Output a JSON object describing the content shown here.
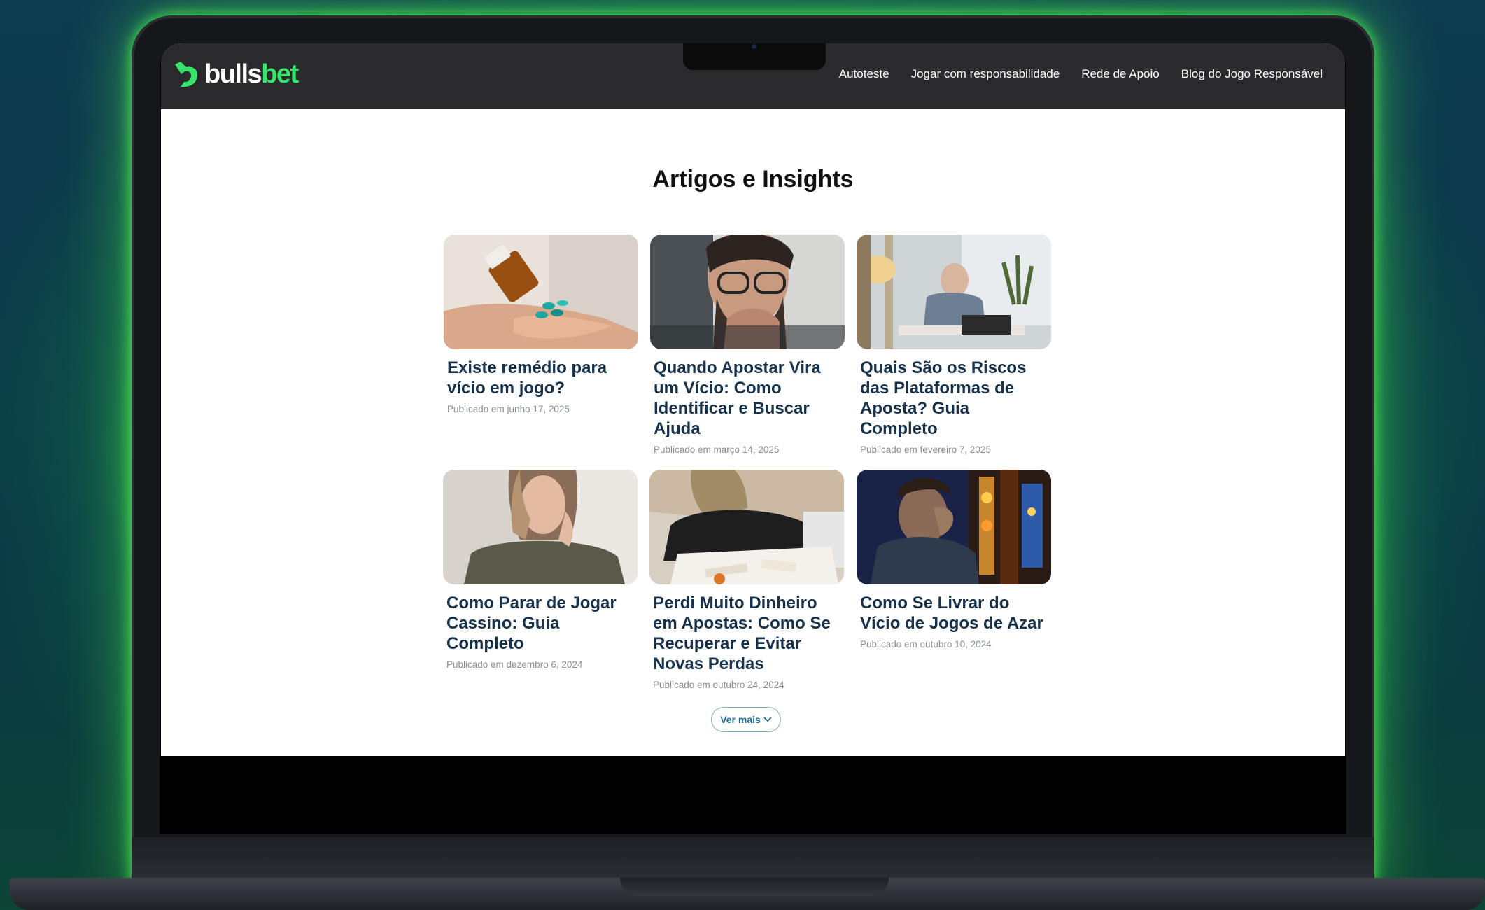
{
  "brand": {
    "name_part1": "bulls",
    "name_part2": "bet",
    "accent_color": "#37e46b",
    "header_bg": "#2a2a2c"
  },
  "nav": {
    "items": [
      {
        "label": "Autoteste"
      },
      {
        "label": "Jogar com responsabilidade"
      },
      {
        "label": "Rede de Apoio"
      },
      {
        "label": "Blog do Jogo Responsável"
      }
    ]
  },
  "main": {
    "title": "Artigos e Insights",
    "articles": [
      {
        "title": "Existe remédio para vício em jogo?",
        "date": "Publicado em junho 17, 2025",
        "image": "pills-in-hand"
      },
      {
        "title": "Quando Apostar Vira um Vício: Como Identificar e Buscar Ajuda",
        "date": "Publicado em março 14, 2025",
        "image": "worried-man-glasses"
      },
      {
        "title": "Quais São os Riscos das Plataformas de Aposta? Guia Completo",
        "date": "Publicado em fevereiro 7, 2025",
        "image": "older-man-phone"
      },
      {
        "title": "Como Parar de Jogar Cassino: Guia Completo",
        "date": "Publicado em dezembro 6, 2024",
        "image": "stressed-woman"
      },
      {
        "title": "Perdi Muito Dinheiro em Apostas: Como Se Recuperar e Evitar Novas Perdas",
        "date": "Publicado em outubro 24, 2024",
        "image": "woman-with-bills"
      },
      {
        "title": "Como Se Livrar do Vício de Jogos de Azar",
        "date": "Publicado em outubro 10, 2024",
        "image": "man-at-slot-machine"
      }
    ],
    "more_button": "Ver mais"
  }
}
